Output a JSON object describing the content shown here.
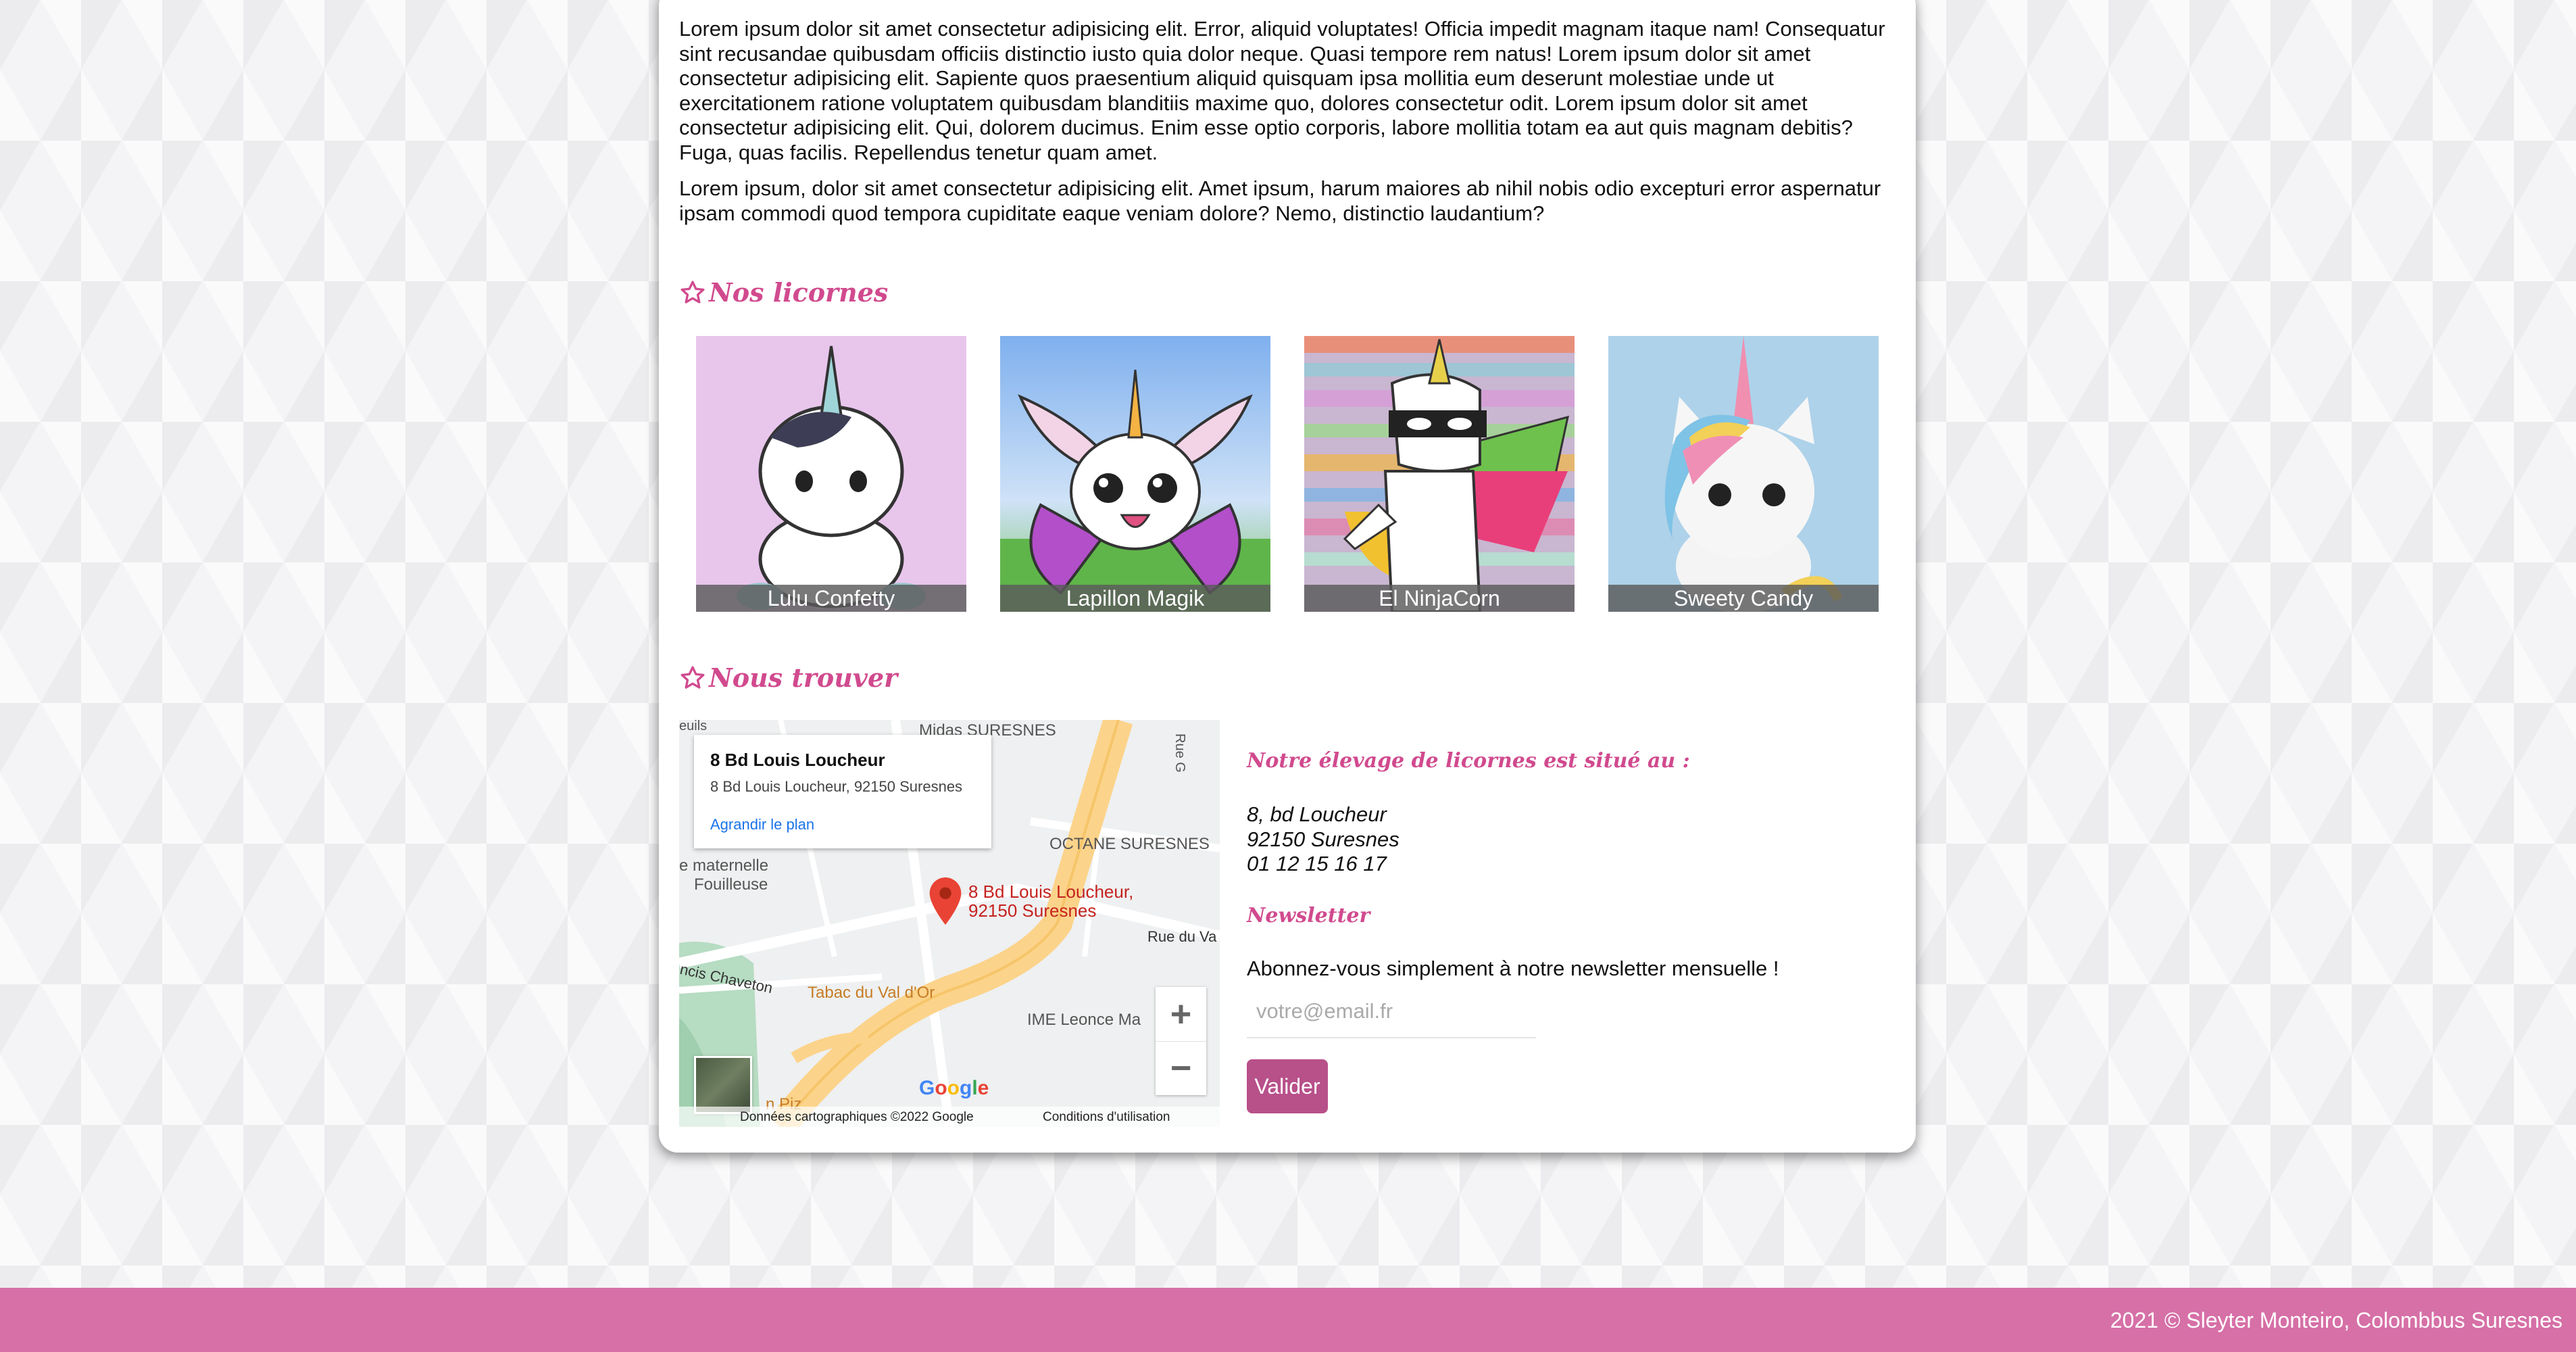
{
  "intro": {
    "paragraph_1": "Lorem ipsum dolor sit amet consectetur adipisicing elit. Error, aliquid voluptates! Officia impedit magnam itaque nam! Consequatur sint recusandae quibusdam officiis distinctio iusto quia dolor neque. Quasi tempore rem natus! Lorem ipsum dolor sit amet consectetur adipisicing elit. Sapiente quos praesentium aliquid quisquam ipsa mollitia eum deserunt molestiae unde ut exercitationem ratione voluptatem quibusdam blanditiis maxime quo, dolores consectetur odit. Lorem ipsum dolor sit amet consectetur adipisicing elit. Qui, dolorem ducimus. Enim esse optio corporis, labore mollitia totam ea aut quis magnam debitis? Fuga, quas facilis. Repellendus tenetur quam amet.",
    "paragraph_2": "Lorem ipsum, dolor sit amet consectetur adipisicing elit. Amet ipsum, harum maiores ab nihil nobis odio excepturi error aspernatur ipsam commodi quod tempora cupiditate eaque veniam dolore? Nemo, distinctio laudantium?"
  },
  "unicorns_section": {
    "title": "Nos licornes",
    "icon": "star-outline-icon",
    "items": [
      {
        "name": "Lulu Confetty",
        "bg": "#e8c6ec"
      },
      {
        "name": "Lapillon Magik",
        "bg": "#bcd6f5"
      },
      {
        "name": "El NinjaCorn",
        "bg": "#c9b6d0"
      },
      {
        "name": "Sweety Candy",
        "bg": "#aed2ea"
      }
    ]
  },
  "find_us_section": {
    "title": "Nous trouver",
    "icon": "star-outline-icon"
  },
  "map": {
    "info_title": "8 Bd Louis Loucheur",
    "info_address": "8 Bd Louis Loucheur, 92150 Suresnes",
    "enlarge_link": "Agrandir le plan",
    "labels": {
      "midas": "Midas SURESNES",
      "octane": "OCTANE SURESNES",
      "maternelle_1": "e maternelle",
      "maternelle_2": "Fouilleuse",
      "rue_du_val": "Rue du Va",
      "rue_g": "Rue G",
      "chaveton": "ncis Chaveton",
      "tabac": "Tabac du Val d'Or",
      "ime": "IME Leonce Ma",
      "piz": "n Piz",
      "euils": "euils"
    },
    "pin_label_1": "8 Bd Louis Loucheur,",
    "pin_label_2": "92150 Suresnes",
    "zoom_in": "+",
    "zoom_out": "−",
    "google": "Google",
    "data_credit": "Données cartographiques ©2022 Google",
    "terms": "Conditions d'utilisation"
  },
  "location": {
    "title": "Notre élevage de licornes est situé au :",
    "address_line_1": "8, bd Loucheur",
    "address_line_2": "92150 Suresnes",
    "phone": "01 12 15 16 17"
  },
  "newsletter": {
    "title": "Newsletter",
    "description": "Abonnez-vous simplement à notre newsletter mensuelle !",
    "email_placeholder": "votre@email.fr",
    "submit_label": "Valider"
  },
  "footer": {
    "text": "2021 © Sleyter Monteiro, Colombbus Suresnes"
  },
  "colors": {
    "accent_pink": "#d14a8e",
    "footer_pink": "#d670a7",
    "button_pink": "#b8508a"
  }
}
